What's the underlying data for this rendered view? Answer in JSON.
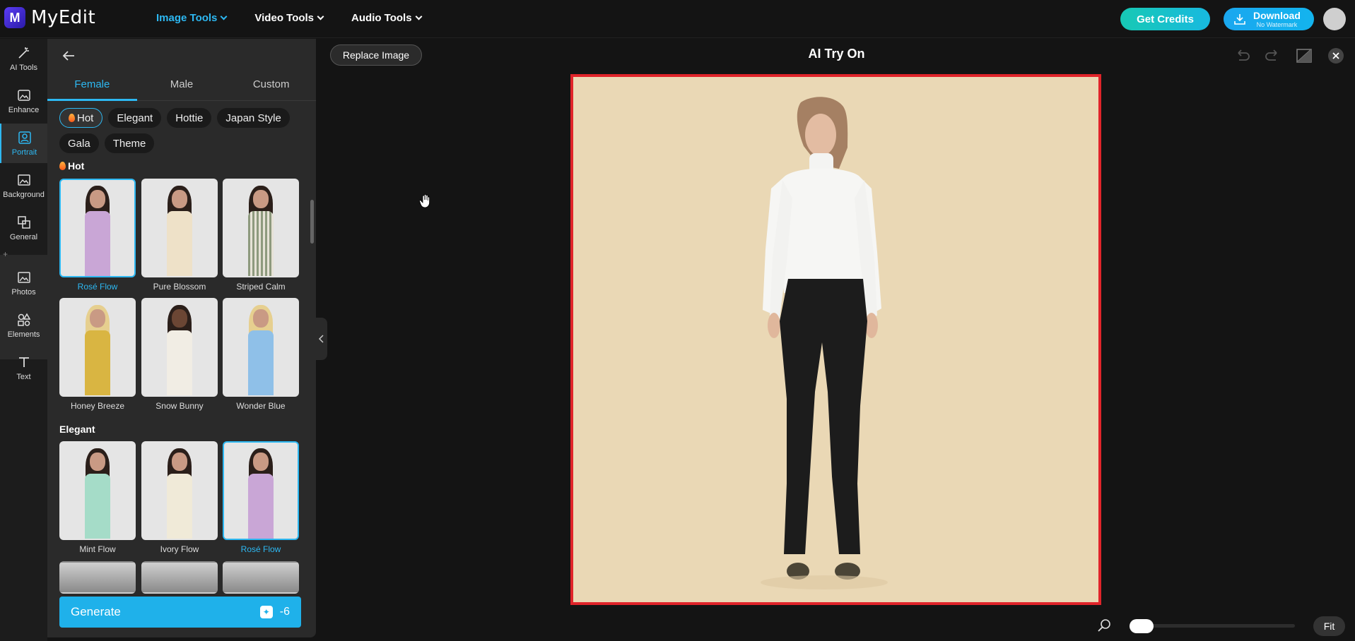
{
  "app": {
    "name": "MyEdit",
    "logo_letter": "M"
  },
  "topnav": [
    {
      "label": "Image Tools",
      "active": true
    },
    {
      "label": "Video Tools",
      "active": false
    },
    {
      "label": "Audio Tools",
      "active": false
    }
  ],
  "header": {
    "credits_label": "Get Credits",
    "download_label": "Download",
    "download_sub": "No Watermark"
  },
  "rail": {
    "items": [
      {
        "label": "AI Tools",
        "icon": "magic-wand-icon"
      },
      {
        "label": "Enhance",
        "icon": "enhance-icon"
      },
      {
        "label": "Portrait",
        "icon": "portrait-icon",
        "active": true
      },
      {
        "label": "Background",
        "icon": "background-icon"
      },
      {
        "label": "General",
        "icon": "general-icon"
      },
      {
        "label": "Photos",
        "icon": "photos-icon"
      },
      {
        "label": "Elements",
        "icon": "elements-icon"
      },
      {
        "label": "Text",
        "icon": "text-icon"
      }
    ]
  },
  "panel": {
    "tabs": [
      {
        "label": "Female",
        "active": true
      },
      {
        "label": "Male",
        "active": false
      },
      {
        "label": "Custom",
        "active": false
      }
    ],
    "chips": [
      {
        "label": "Hot",
        "active": true
      },
      {
        "label": "Elegant"
      },
      {
        "label": "Hottie"
      },
      {
        "label": "Japan Style"
      },
      {
        "label": "Gala"
      },
      {
        "label": "Theme"
      }
    ],
    "sections": {
      "hot_title": "Hot",
      "elegant_title": "Elegant"
    },
    "hot_items": [
      {
        "name": "Rosé Flow",
        "selected": true,
        "color": "#c9a6d6"
      },
      {
        "name": "Pure Blossom",
        "color": "#eee1c8"
      },
      {
        "name": "Striped Calm",
        "color": "#8e9a7e"
      },
      {
        "name": "Honey Breeze",
        "color": "#d9b542"
      },
      {
        "name": "Snow Bunny",
        "color": "#f1ede4"
      },
      {
        "name": "Wonder Blue",
        "color": "#8fc0e8"
      }
    ],
    "elegant_items": [
      {
        "name": "Mint Flow",
        "color": "#a5dcc8"
      },
      {
        "name": "Ivory Flow",
        "color": "#f0ead8"
      },
      {
        "name": "Rosé Flow",
        "selected": true,
        "color": "#c9a6d6"
      }
    ],
    "generate_label": "Generate",
    "generate_cost": "-6"
  },
  "canvas": {
    "replace_label": "Replace Image",
    "title": "AI Try On",
    "fit_label": "Fit",
    "zoom_level": 0.0,
    "colors": {
      "accent": "#2db8f2",
      "frame_border": "#e0242a",
      "backdrop": "#ead8b5"
    }
  }
}
